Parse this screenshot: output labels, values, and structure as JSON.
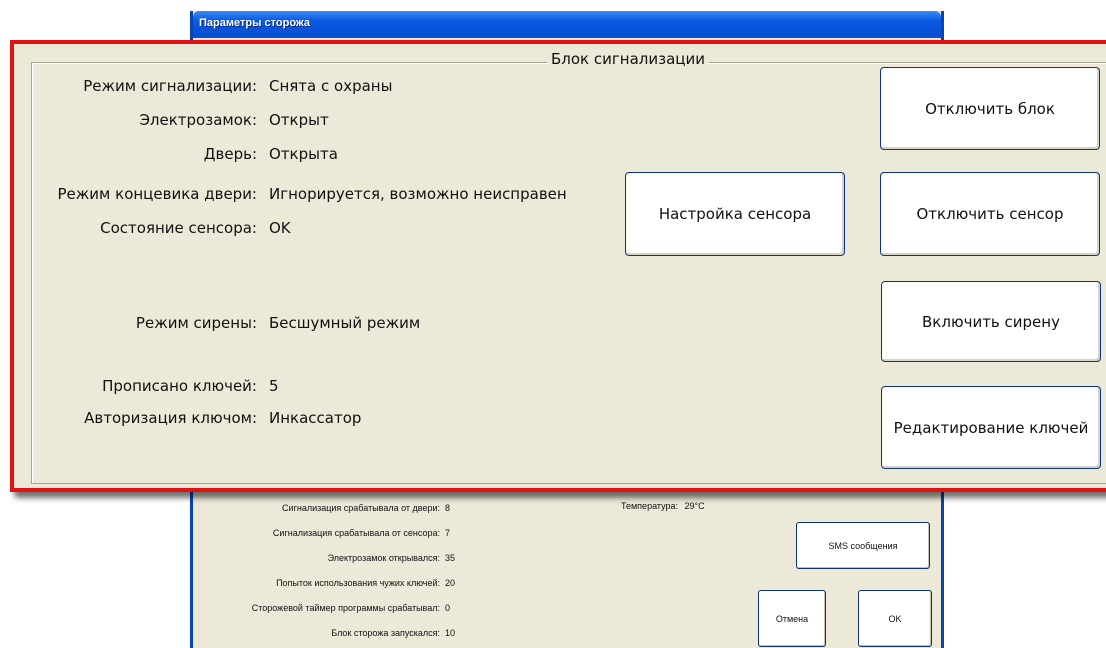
{
  "window": {
    "title": "Параметры сторожа"
  },
  "alarm_block": {
    "legend": "Блок сигнализации",
    "fields": [
      {
        "label": "Режим сигнализации:",
        "value": "Снята с охраны"
      },
      {
        "label": "Электрозамок:",
        "value": "Открыт"
      },
      {
        "label": "Дверь:",
        "value": "Открыта"
      },
      {
        "label": "Режим концевика двери:",
        "value": "Игнорируется, возможно неисправен"
      },
      {
        "label": "Состояние сенсора:",
        "value": "OK"
      },
      {
        "label": "Режим сирены:",
        "value": "Бесшумный режим"
      },
      {
        "label": "Прописано ключей:",
        "value": "5"
      },
      {
        "label": "Авторизация ключом:",
        "value": "Инкассатор"
      }
    ],
    "buttons": {
      "disable_block": "Отключить блок",
      "sensor_setup": "Настройка сенсора",
      "disable_sensor": "Отключить сенсор",
      "enable_siren": "Включить сирену",
      "edit_keys": "Редактирование ключей"
    }
  },
  "stats": [
    {
      "label": "Сигнализация срабатывала от двери:",
      "value": "8"
    },
    {
      "label": "Сигнализация срабатывала от сенсора:",
      "value": "7"
    },
    {
      "label": "Электрозамок открывался:",
      "value": "35"
    },
    {
      "label": "Попыток использования чужих ключей:",
      "value": "20"
    },
    {
      "label": "Сторожевой таймер программы срабатывал:",
      "value": "0"
    },
    {
      "label": "Блок сторожа запускался:",
      "value": "10"
    }
  ],
  "temperature": {
    "label": "Температура:",
    "value": "29°C"
  },
  "footer_buttons": {
    "sms": "SMS сообщения",
    "cancel": "Отмена",
    "ok": "OK"
  },
  "colors": {
    "highlight_border": "#e01212",
    "titlebar": "#0753d9",
    "dialog_background": "#ece9d8"
  }
}
